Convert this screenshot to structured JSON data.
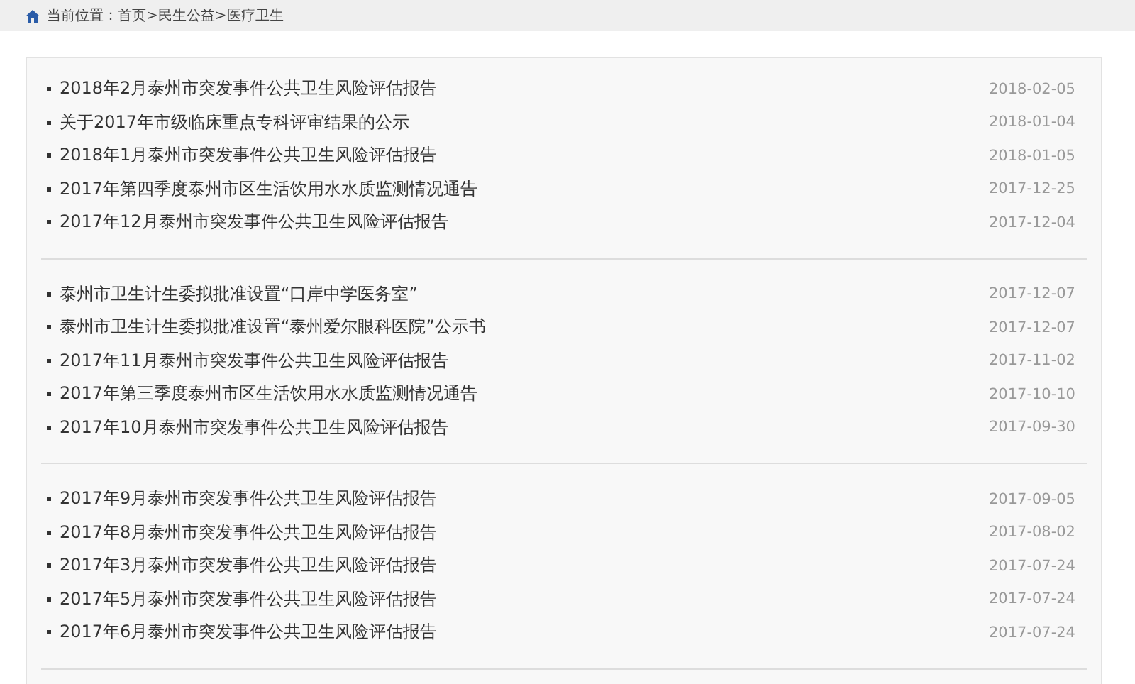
{
  "breadcrumb": {
    "text": "当前位置：首页>民生公益>医疗卫生"
  },
  "groups": [
    {
      "items": [
        {
          "title": "2018年2月泰州市突发事件公共卫生风险评估报告",
          "date": "2018-02-05"
        },
        {
          "title": "关于2017年市级临床重点专科评审结果的公示",
          "date": "2018-01-04"
        },
        {
          "title": "2018年1月泰州市突发事件公共卫生风险评估报告",
          "date": "2018-01-05"
        },
        {
          "title": "2017年第四季度泰州市区生活饮用水水质监测情况通告",
          "date": "2017-12-25"
        },
        {
          "title": "2017年12月泰州市突发事件公共卫生风险评估报告",
          "date": "2017-12-04"
        }
      ]
    },
    {
      "items": [
        {
          "title": "泰州市卫生计生委拟批准设置“口岸中学医务室”",
          "date": "2017-12-07"
        },
        {
          "title": "泰州市卫生计生委拟批准设置“泰州爱尔眼科医院”公示书",
          "date": "2017-12-07"
        },
        {
          "title": "2017年11月泰州市突发事件公共卫生风险评估报告",
          "date": "2017-11-02"
        },
        {
          "title": "2017年第三季度泰州市区生活饮用水水质监测情况通告",
          "date": "2017-10-10"
        },
        {
          "title": "2017年10月泰州市突发事件公共卫生风险评估报告",
          "date": "2017-09-30"
        }
      ]
    },
    {
      "items": [
        {
          "title": "2017年9月泰州市突发事件公共卫生风险评估报告",
          "date": "2017-09-05"
        },
        {
          "title": "2017年8月泰州市突发事件公共卫生风险评估报告",
          "date": "2017-08-02"
        },
        {
          "title": "2017年3月泰州市突发事件公共卫生风险评估报告",
          "date": "2017-07-24"
        },
        {
          "title": "2017年5月泰州市突发事件公共卫生风险评估报告",
          "date": "2017-07-24"
        },
        {
          "title": "2017年6月泰州市突发事件公共卫生风险评估报告",
          "date": "2017-07-24"
        }
      ]
    }
  ]
}
